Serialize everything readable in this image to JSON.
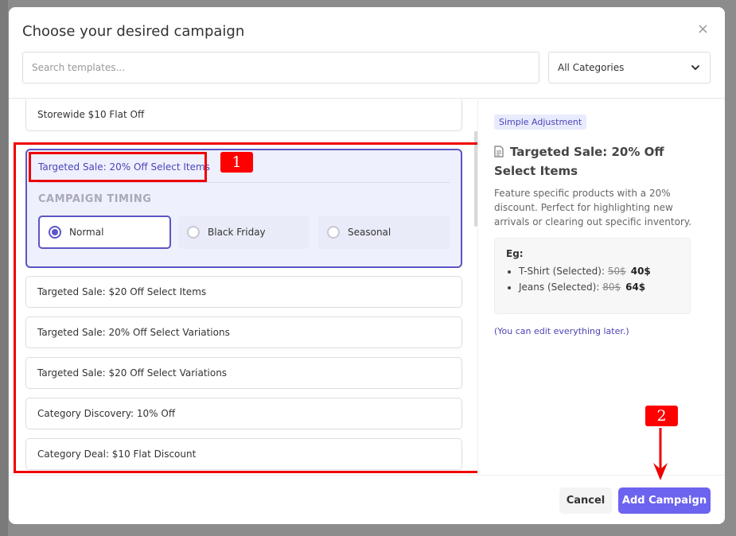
{
  "header": {
    "title": "Choose your desired campaign",
    "close_glyph": "×",
    "search_placeholder": "Search templates...",
    "category_selected": "All Categories"
  },
  "templates": [
    {
      "label": "Storewide $10 Flat Off"
    },
    {
      "label": "Targeted Sale: 20% Off Select Items"
    },
    {
      "label": "Targeted Sale: $20 Off Select Items"
    },
    {
      "label": "Targeted Sale: 20% Off Select Variations"
    },
    {
      "label": "Targeted Sale: $20 Off Select Variations"
    },
    {
      "label": "Category Discovery: 10% Off"
    },
    {
      "label": "Category Deal: $10 Flat Discount"
    }
  ],
  "timing": {
    "label": "CAMPAIGN TIMING",
    "options": [
      {
        "label": "Normal",
        "checked": true
      },
      {
        "label": "Black Friday",
        "checked": false
      },
      {
        "label": "Seasonal",
        "checked": false
      }
    ]
  },
  "detail": {
    "tag": "Simple Adjustment",
    "title": "Targeted Sale: 20% Off Select Items",
    "description": "Feature specific products with a 20% discount. Perfect for highlighting new arrivals or clearing out specific inventory.",
    "example_label": "Eg:",
    "examples": [
      {
        "name": "T-Shirt (Selected):",
        "old": "50$",
        "new": "40$"
      },
      {
        "name": "Jeans (Selected):",
        "old": "80$",
        "new": "64$"
      }
    ],
    "note": "(You can edit everything later.)"
  },
  "footer": {
    "cancel_label": "Cancel",
    "add_label": "Add Campaign"
  },
  "annotations": {
    "badge_1": "1",
    "badge_2": "2"
  },
  "colors": {
    "accent": "#5b55c6",
    "primary_button": "#6c63ef",
    "annotation": "#ee0000"
  }
}
